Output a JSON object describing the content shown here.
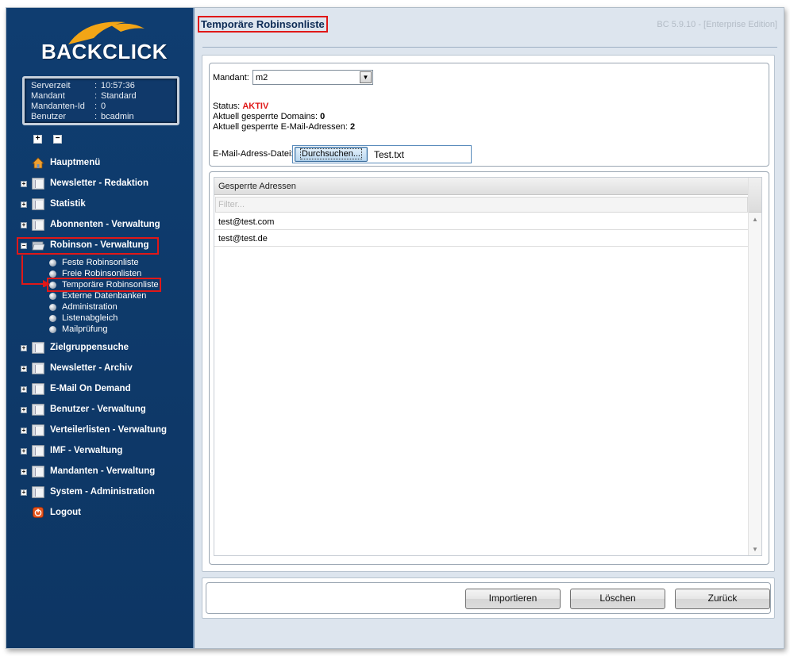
{
  "app": {
    "logo_text": "BACKCLICK",
    "version": "BC 5.9.10 - [Enterprise Edition]"
  },
  "info": [
    {
      "key": "Serverzeit",
      "sep": ":",
      "value": "10:57:36"
    },
    {
      "key": "Mandant",
      "sep": ":",
      "value": "Standard"
    },
    {
      "key": "Mandanten-Id",
      "sep": ":",
      "value": "0"
    },
    {
      "key": "Benutzer",
      "sep": ":",
      "value": "bcadmin"
    }
  ],
  "tree_controls": {
    "expand": "+",
    "collapse": "−"
  },
  "nav": {
    "hauptmenue": "Hauptmenü",
    "newsletter_redaktion": "Newsletter - Redaktion",
    "statistik": "Statistik",
    "abonnenten": "Abonnenten - Verwaltung",
    "robinson": "Robinson - Verwaltung",
    "robinson_sub": [
      "Feste Robinsonliste",
      "Freie Robinsonlisten",
      "Temporäre Robinsonliste",
      "Externe Datenbanken",
      "Administration",
      "Listenabgleich",
      "Mailprüfung"
    ],
    "zielgruppensuche": "Zielgruppensuche",
    "newsletter_archiv": "Newsletter - Archiv",
    "email_on_demand": "E-Mail On Demand",
    "benutzer": "Benutzer - Verwaltung",
    "verteilerlisten": "Verteilerlisten - Verwaltung",
    "imf": "IMF - Verwaltung",
    "mandanten": "Mandanten - Verwaltung",
    "system": "System - Administration",
    "logout": "Logout"
  },
  "page": {
    "title": "Temporäre Robinsonliste"
  },
  "form": {
    "mandant_label": "Mandant:",
    "mandant_value": "m2",
    "status_label": "Status:",
    "status_value": "AKTIV",
    "domains_label": "Aktuell gesperrte Domains:",
    "domains_value": "0",
    "emails_label": "Aktuell gesperrte E-Mail-Adressen:",
    "emails_value": "2",
    "file_label": "E-Mail-Adress-Datei:",
    "browse_label": "Durchsuchen...",
    "file_name": "Test.txt"
  },
  "grid": {
    "header": "Gesperrte Adressen",
    "filter_placeholder": "Filter...",
    "rows": [
      "test@test.com",
      "test@test.de"
    ]
  },
  "actions": {
    "import": "Importieren",
    "delete": "Löschen",
    "back": "Zurück"
  },
  "colors": {
    "sidebar_bg": "#0e3a6b",
    "highlight_red": "#e01818",
    "status_red": "#e01818"
  }
}
